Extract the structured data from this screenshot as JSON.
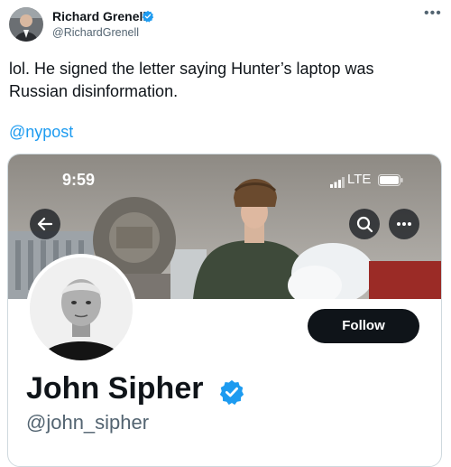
{
  "tweet": {
    "author_name": "Richard Grenell",
    "author_handle": "@RichardGrenell",
    "text": "lol. He signed the letter saying Hunter’s laptop was Russian disinformation.",
    "mention": "@nypost"
  },
  "embedded_screenshot": {
    "status_bar": {
      "time": "9:59",
      "network": "LTE"
    },
    "profile": {
      "name": "John Sipher",
      "handle": "@john_sipher",
      "follow_label": "Follow"
    }
  },
  "colors": {
    "accent": "#1d9bf0",
    "verified_badge": "#1d9bf0",
    "follow_button": "#0f1419",
    "secondary_text": "#536471"
  },
  "icons": [
    "verified-badge-icon",
    "more-icon",
    "back-arrow-icon",
    "search-icon",
    "more-horizontal-icon",
    "signal-icon",
    "battery-icon"
  ]
}
